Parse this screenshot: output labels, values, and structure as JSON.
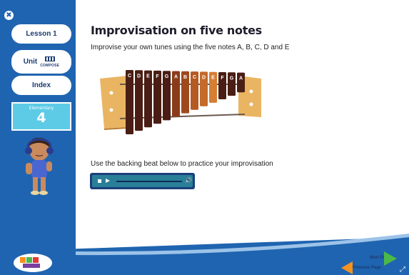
{
  "sidebar": {
    "close_glyph": "✖",
    "lesson_label": "Lesson 1",
    "unit_label": "Unit",
    "unit_sub": "COMPOSE",
    "index_label": "Index",
    "level_label": "Elementary",
    "level_number": "4"
  },
  "main": {
    "title": "Improvisation on five notes",
    "instruction": "Improvise your own tunes using the five notes A, B, C, D and E",
    "backing_instruction": "Use the backing beat below to practice your improvisation"
  },
  "xylophone": {
    "bars": [
      {
        "note": "C",
        "color": "#4a1e14"
      },
      {
        "note": "D",
        "color": "#4a1e14"
      },
      {
        "note": "E",
        "color": "#4a1e14"
      },
      {
        "note": "F",
        "color": "#4a1e14"
      },
      {
        "note": "G",
        "color": "#4a1e14"
      },
      {
        "note": "A",
        "color": "#8a3c19"
      },
      {
        "note": "B",
        "color": "#9e4a1c"
      },
      {
        "note": "C",
        "color": "#b55a22"
      },
      {
        "note": "D",
        "color": "#c46a2a"
      },
      {
        "note": "E",
        "color": "#d67e33"
      },
      {
        "note": "F",
        "color": "#4a1e14"
      },
      {
        "note": "G",
        "color": "#4a1e14"
      },
      {
        "note": "A",
        "color": "#4a1e14"
      }
    ],
    "frame_color": "#f2c976"
  },
  "player": {
    "volume_glyph": "🔊"
  },
  "nav": {
    "next_label": "Next Page",
    "prev_label": "Previous Page"
  },
  "colors": {
    "sidebar_blue": "#1f64b0",
    "level_cyan": "#5ecbe6",
    "next_green": "#4cb848",
    "prev_orange": "#f39220"
  }
}
